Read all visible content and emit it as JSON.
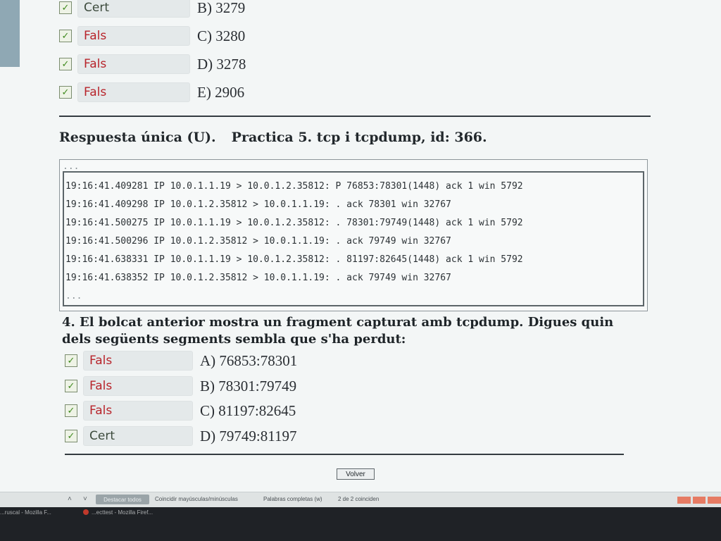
{
  "previous_question": {
    "answers": [
      {
        "verdict": "Cert",
        "option": "B) 3279"
      },
      {
        "verdict": "Fals",
        "option": "C) 3280"
      },
      {
        "verdict": "Fals",
        "option": "D) 3278"
      },
      {
        "verdict": "Fals",
        "option": "E) 2906"
      }
    ]
  },
  "section_header": {
    "type": "Respuesta única (U).",
    "title": "Practica 5. tcp i tcpdump, id: 366."
  },
  "dump": {
    "ellipsis": "...",
    "lines": [
      "19:16:41.409281 IP 10.0.1.1.19 > 10.0.1.2.35812: P 76853:78301(1448) ack 1 win 5792",
      "19:16:41.409298 IP 10.0.1.2.35812 > 10.0.1.1.19: . ack 78301 win 32767",
      "19:16:41.500275 IP 10.0.1.1.19 > 10.0.1.2.35812: . 78301:79749(1448) ack 1 win 5792",
      "19:16:41.500296 IP 10.0.1.2.35812 > 10.0.1.1.19: . ack 79749 win 32767",
      "19:16:41.638331 IP 10.0.1.1.19 > 10.0.1.2.35812: . 81197:82645(1448) ack 1 win 5792",
      "19:16:41.638352 IP 10.0.1.2.35812 > 10.0.1.1.19: . ack 79749 win 32767"
    ]
  },
  "question": {
    "text": "4. El bolcat anterior mostra un fragment capturat amb tcpdump.  Digues quin dels següents segments sembla que s'ha perdut:",
    "answers": [
      {
        "verdict": "Fals",
        "option": "A) 76853:78301"
      },
      {
        "verdict": "Fals",
        "option": "B) 78301:79749"
      },
      {
        "verdict": "Fals",
        "option": "C) 81197:82645"
      },
      {
        "verdict": "Cert",
        "option": "D) 79749:81197"
      }
    ]
  },
  "volver_label": "Volver",
  "findbar": {
    "highlight_all": "Destacar todos",
    "match_case": "Coincidir mayúsculas/minúsculas",
    "whole_words": "Palabras completas (w)",
    "result": "2 de 2 coinciden"
  },
  "taskbar": {
    "item1": "...ruscal - Mozilla F...",
    "item2": "...ecttest - Mozilla Firef..."
  },
  "icons": {
    "checkbox": "check-mark",
    "find_prev": "chevron-up",
    "find_next": "chevron-down"
  },
  "colors": {
    "fals": "#b8242b",
    "cert": "#3c4a3c",
    "check": "#3f8a1e"
  }
}
